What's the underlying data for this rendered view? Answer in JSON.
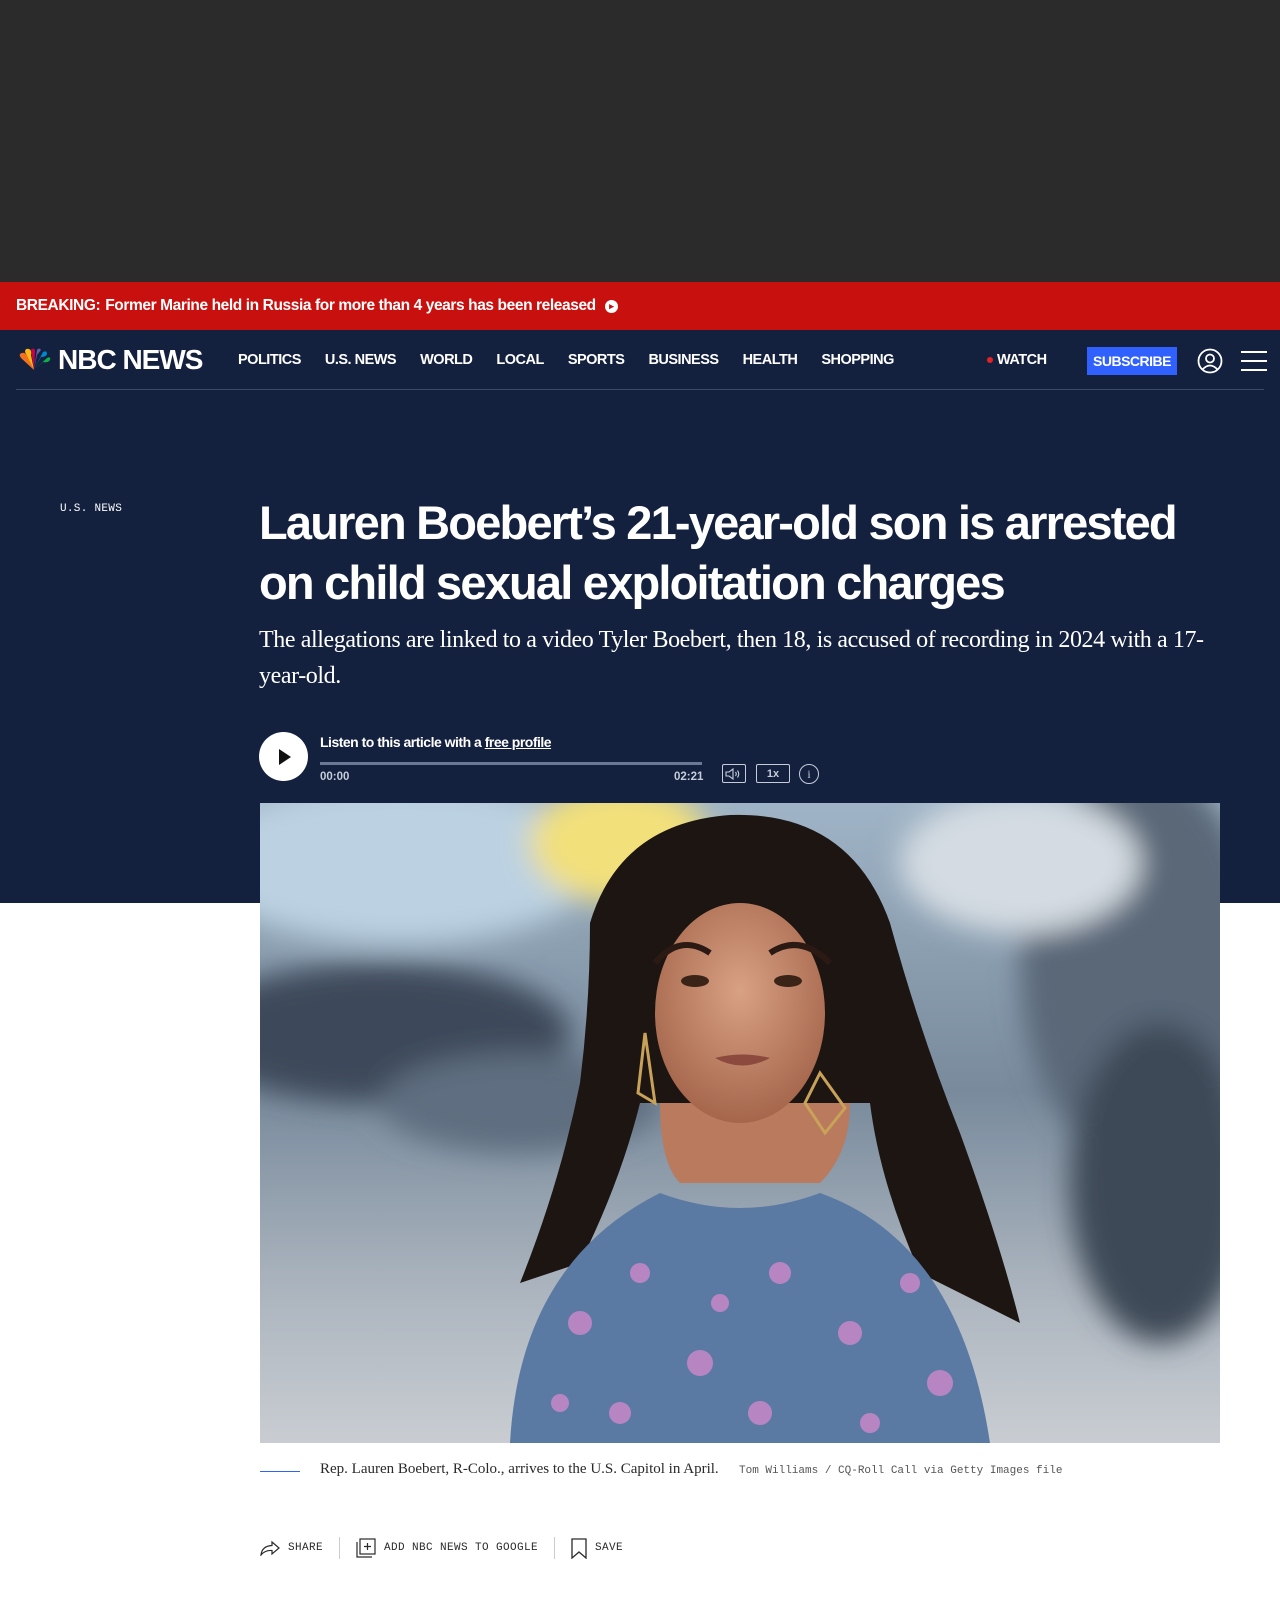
{
  "breaking": {
    "label": "BREAKING:",
    "text": "Former Marine held in Russia for more than 4 years has been released"
  },
  "nav": {
    "logo": "NBC NEWS",
    "links": [
      "POLITICS",
      "U.S. NEWS",
      "WORLD",
      "LOCAL",
      "SPORTS",
      "BUSINESS",
      "HEALTH",
      "SHOPPING"
    ],
    "watch": "WATCH",
    "subscribe": "SUBSCRIBE"
  },
  "article": {
    "category": "U.S. NEWS",
    "headline": "Lauren Boebert’s 21-year-old son is arrested on child sexual exploitation charges",
    "dek": "The allegations are linked to a video Tyler Boebert, then 18, is accused of recording in 2024 with a 17-year-old."
  },
  "player": {
    "listen_prefix": "Listen to this article with a ",
    "listen_link": "free profile",
    "current_time": "00:00",
    "duration": "02:21",
    "speed": "1x",
    "progress": 0
  },
  "photo": {
    "caption": "Rep. Lauren Boebert, R-Colo., arrives to the U.S. Capitol in April.",
    "credit": "Tom Williams / CQ-Roll Call via Getty Images file"
  },
  "actions": {
    "share": "SHARE",
    "google": "ADD NBC NEWS TO GOOGLE",
    "save": "SAVE"
  },
  "colors": {
    "breaking_red": "#c8110f",
    "navy": "#13203e",
    "subscribe_blue": "#3061ff"
  }
}
